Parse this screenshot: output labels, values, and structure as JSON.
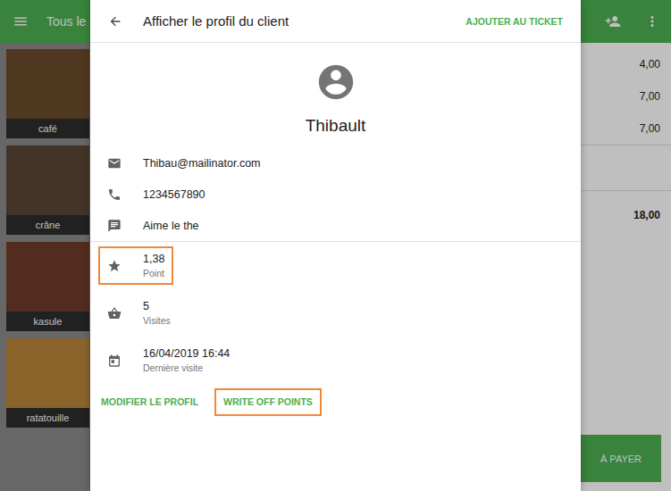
{
  "app_bar": {
    "title": "Tous le"
  },
  "products": [
    {
      "label": "café",
      "color": "#6b4a2a"
    },
    {
      "label": "crâne",
      "color": "#5a4634"
    },
    {
      "label": "kasule",
      "color": "#6e3b28"
    },
    {
      "label": "ratatouille",
      "color": "#b8863a"
    }
  ],
  "ticket": {
    "prices": [
      "4,00",
      "7,00",
      "7,00"
    ],
    "total": "18,00",
    "pay_button": "À PAYER"
  },
  "dialog": {
    "title": "Afficher le profil du client",
    "action": "AJOUTER AU TICKET",
    "customer": {
      "name": "Thibault"
    },
    "contacts": [
      {
        "kind": "email",
        "text": "Thibau@mailinator.com"
      },
      {
        "kind": "phone",
        "text": "1234567890"
      },
      {
        "kind": "note",
        "text": "Aime le the"
      }
    ],
    "stats": [
      {
        "kind": "points",
        "value": "1,38",
        "label": "Point",
        "highlighted": true
      },
      {
        "kind": "visits",
        "value": "5",
        "label": "Visites",
        "highlighted": false
      },
      {
        "kind": "last_visit",
        "value": "16/04/2019 16:44",
        "label": "Dernière visite",
        "highlighted": false
      }
    ],
    "buttons": [
      {
        "label": "MODIFIER LE PROFIL",
        "highlighted": false
      },
      {
        "label": "WRITE OFF POINTS",
        "highlighted": true
      }
    ]
  }
}
